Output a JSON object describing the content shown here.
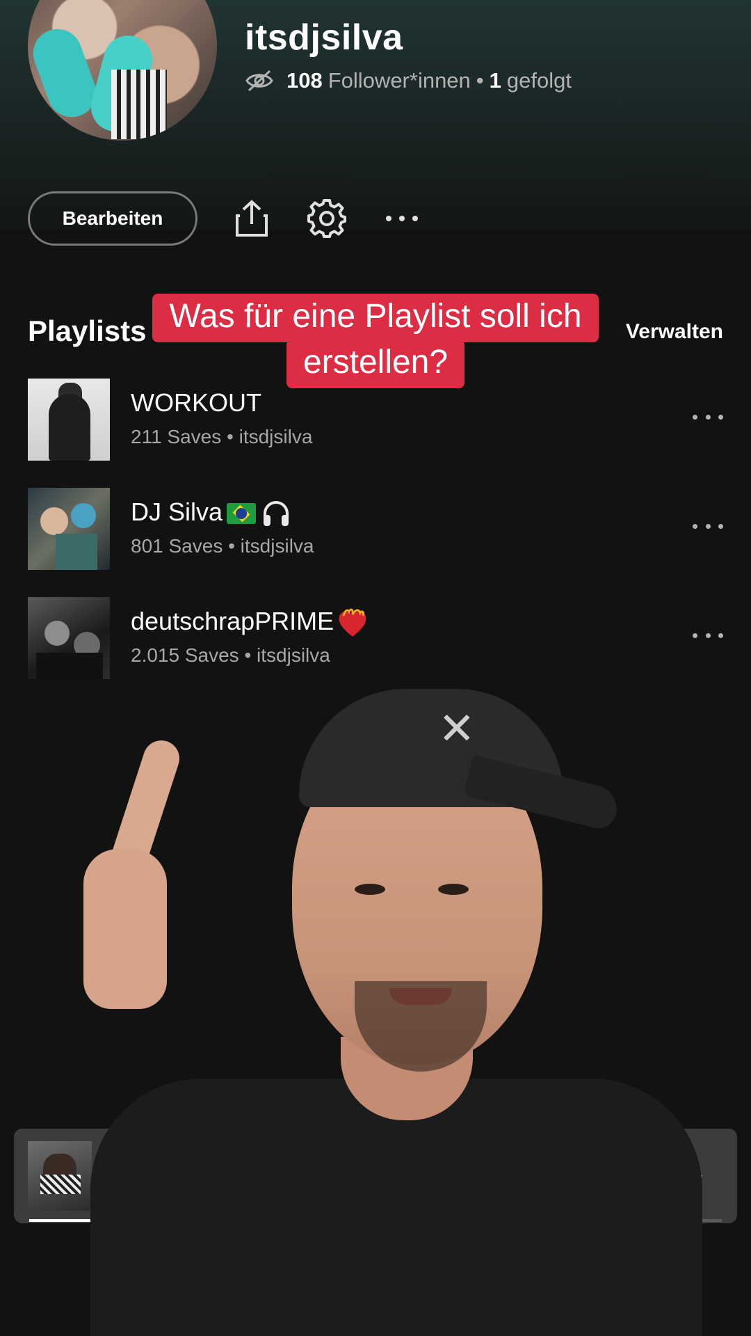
{
  "profile": {
    "username": "itsdjsilva",
    "followers_count": "108",
    "followers_label": "Follower*innen",
    "following_count": "1",
    "following_label": "gefolgt",
    "separator": "•"
  },
  "actions": {
    "edit_label": "Bearbeiten",
    "share_icon": "share-icon",
    "settings_icon": "gear-icon",
    "more_icon": "more-horizontal-icon"
  },
  "section": {
    "title": "Playlists",
    "manage_label": "Verwalten"
  },
  "caption": {
    "line1": "Was für eine Playlist soll ich",
    "line2": "erstellen?",
    "background": "#dd2d45"
  },
  "playlists": [
    {
      "title": "WORKOUT",
      "subtitle": "211 Saves • itsdjsilva"
    },
    {
      "title": "DJ Silva",
      "subtitle": "801 Saves • itsdjsilva"
    },
    {
      "title": "deutschrapPRIME",
      "subtitle": "2.015 Saves • itsdjsilva"
    }
  ],
  "miniplayer": {
    "progress": 0.09,
    "play_icon": "play-icon"
  },
  "colors": {
    "background": "#121212",
    "header_gradient_top": "#203432",
    "secondary_text": "#a7a7a7"
  }
}
